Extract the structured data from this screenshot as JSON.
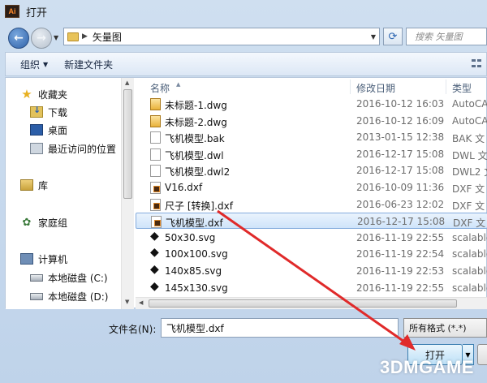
{
  "window": {
    "title": "打开",
    "app_icon_text": "Ai"
  },
  "address": {
    "folder": "矢量图",
    "search_placeholder": "搜索 矢量图"
  },
  "toolbar": {
    "organize": "组织",
    "new_folder": "新建文件夹"
  },
  "sidebar": {
    "favorites": "收藏夹",
    "downloads": "下载",
    "desktop": "桌面",
    "recent": "最近访问的位置",
    "libraries": "库",
    "homegroup": "家庭组",
    "computer": "计算机",
    "disk_c": "本地磁盘 (C:)",
    "disk_d": "本地磁盘 (D:)"
  },
  "columns": {
    "name": "名称",
    "modified": "修改日期",
    "type": "类型"
  },
  "files": [
    {
      "name": "未标题-1.dwg",
      "date": "2016-10-12 16:03",
      "type": "AutoCA",
      "icon": "dwg-icon"
    },
    {
      "name": "未标题-2.dwg",
      "date": "2016-10-12 16:09",
      "type": "AutoCA",
      "icon": "dwg-icon"
    },
    {
      "name": "飞机模型.bak",
      "date": "2013-01-15 12:38",
      "type": "BAK 文",
      "icon": "doc-icon"
    },
    {
      "name": "飞机模型.dwl",
      "date": "2016-12-17 15:08",
      "type": "DWL 文",
      "icon": "doc-icon"
    },
    {
      "name": "飞机模型.dwl2",
      "date": "2016-12-17 15:08",
      "type": "DWL2 文",
      "icon": "doc-icon"
    },
    {
      "name": "V16.dxf",
      "date": "2016-10-09 11:36",
      "type": "DXF 文",
      "icon": "dxf-icon"
    },
    {
      "name": "尺子 [转换].dxf",
      "date": "2016-06-23 12:02",
      "type": "DXF 文",
      "icon": "dxf-icon"
    },
    {
      "name": "飞机模型.dxf",
      "date": "2016-12-17 15:08",
      "type": "DXF 文",
      "icon": "dxf-icon",
      "selected": true
    },
    {
      "name": "50x30.svg",
      "date": "2016-11-19 22:55",
      "type": "scalable",
      "icon": "svg-icon"
    },
    {
      "name": "100x100.svg",
      "date": "2016-11-19 22:54",
      "type": "scalable",
      "icon": "svg-icon"
    },
    {
      "name": "140x85.svg",
      "date": "2016-11-19 22:53",
      "type": "scalable",
      "icon": "svg-icon"
    },
    {
      "name": "145x130.svg",
      "date": "2016-11-19 22:55",
      "type": "scalable",
      "icon": "svg-icon"
    }
  ],
  "bottom": {
    "filename_label": "文件名(N):",
    "filename_value": "飞机模型.dxf",
    "filetype": "所有格式 (*.*)",
    "open_label": "打开"
  },
  "watermark": "3DMGAME",
  "colors": {
    "arrow": "#e02a2a",
    "selection": "#cfe4fa"
  }
}
